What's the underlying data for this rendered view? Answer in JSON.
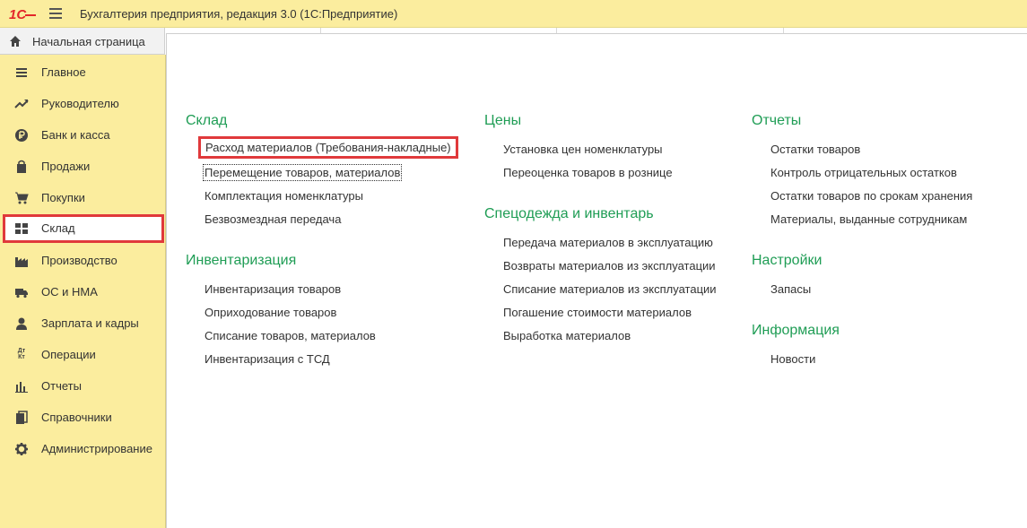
{
  "titlebar": {
    "app_title": "Бухгалтерия предприятия, редакция 3.0  (1С:Предприятие)",
    "logo_text": "1С"
  },
  "home_tab": {
    "label": "Начальная страница"
  },
  "sidebar": {
    "items": [
      {
        "label": "Главное",
        "icon": "list-icon"
      },
      {
        "label": "Руководителю",
        "icon": "trend-icon"
      },
      {
        "label": "Банк и касса",
        "icon": "ruble-icon"
      },
      {
        "label": "Продажи",
        "icon": "bag-icon"
      },
      {
        "label": "Покупки",
        "icon": "cart-icon"
      },
      {
        "label": "Склад",
        "icon": "warehouse-icon",
        "selected": true
      },
      {
        "label": "Производство",
        "icon": "factory-icon"
      },
      {
        "label": "ОС и НМА",
        "icon": "truck-icon"
      },
      {
        "label": "Зарплата и кадры",
        "icon": "person-icon"
      },
      {
        "label": "Операции",
        "icon": "dt-kt-icon"
      },
      {
        "label": "Отчеты",
        "icon": "bar-chart-icon"
      },
      {
        "label": "Справочники",
        "icon": "books-icon"
      },
      {
        "label": "Администрирование",
        "icon": "gear-icon"
      }
    ],
    "dt_kt_text": "Дт Кт"
  },
  "content": {
    "sklad": {
      "title": "Склад",
      "links": [
        "Расход материалов (Требования-накладные)",
        "Перемещение товаров, материалов",
        "Комплектация номенклатуры",
        "Безвозмездная передача"
      ]
    },
    "inventarizatsiya": {
      "title": "Инвентаризация",
      "links": [
        "Инвентаризация товаров",
        "Оприходование товаров",
        "Списание товаров, материалов",
        "Инвентаризация с ТСД"
      ]
    },
    "tseny": {
      "title": "Цены",
      "links": [
        "Установка цен номенклатуры",
        "Переоценка товаров в рознице"
      ]
    },
    "spetsodezhda": {
      "title": "Спецодежда и инвентарь",
      "links": [
        "Передача материалов в эксплуатацию",
        "Возвраты материалов из эксплуатации",
        "Списание материалов из эксплуатации",
        "Погашение стоимости материалов",
        "Выработка материалов"
      ]
    },
    "otchety": {
      "title": "Отчеты",
      "links": [
        "Остатки товаров",
        "Контроль отрицательных остатков",
        "Остатки товаров по срокам хранения",
        "Материалы, выданные сотрудникам"
      ]
    },
    "nastroyki": {
      "title": "Настройки",
      "links": [
        "Запасы"
      ]
    },
    "informatsiya": {
      "title": "Информация",
      "links": [
        "Новости"
      ]
    }
  },
  "colors": {
    "accent_yellow": "#fbed9e",
    "section_green": "#1f9d55",
    "highlight_red": "#e0393b",
    "logo_red": "#e3272a"
  }
}
